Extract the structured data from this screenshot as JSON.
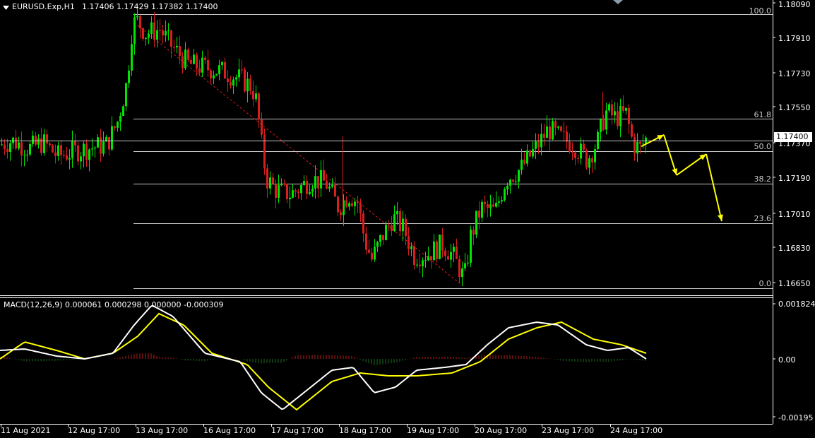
{
  "header": {
    "symbol": "EURUSD.Exp,H1",
    "ohlc": "1.17406 1.17429 1.17382 1.17400",
    "dropdown_icon": "triangle-down-icon"
  },
  "price_axis": {
    "labels": [
      "1.18090",
      "1.17910",
      "1.17730",
      "1.17550",
      "1.17370",
      "1.17190",
      "1.17010",
      "1.16830",
      "1.16650"
    ],
    "current_price": "1.17400"
  },
  "fibonacci": {
    "levels": [
      "100.0",
      "61.8",
      "50.0",
      "38.2",
      "23.6",
      "0.0"
    ]
  },
  "macd": {
    "title": "MACD(12,26,9) 0.000061 0.000298 0.000000 -0.000309",
    "axis_labels": [
      "0.001824",
      "0.00",
      "-0.00195"
    ]
  },
  "time_axis": {
    "labels": [
      "11 Aug 2021",
      "12 Aug 17:00",
      "13 Aug 17:00",
      "16 Aug 17:00",
      "17 Aug 17:00",
      "18 Aug 17:00",
      "19 Aug 17:00",
      "20 Aug 17:00",
      "23 Aug 17:00",
      "24 Aug 17:00"
    ]
  },
  "colors": {
    "bull": "#00e600",
    "bear": "#d81e1e",
    "macd_line": "#ffffff",
    "signal_line": "#ffff00",
    "projection": "#ffff00",
    "fib_line": "#c8c8c8"
  },
  "chart_data": {
    "type": "line",
    "title": "EURUSD.Exp,H1",
    "price_series": {
      "name": "EURUSD",
      "ylim": [
        1.166,
        1.181
      ],
      "x": [
        "11 Aug 2021",
        "12 Aug 17:00",
        "13 Aug 17:00",
        "16 Aug 17:00",
        "17 Aug 17:00",
        "18 Aug 17:00",
        "19 Aug 17:00",
        "20 Aug 17:00",
        "23 Aug 17:00",
        "24 Aug 17:00"
      ],
      "close": [
        1.1738,
        1.1738,
        1.1797,
        1.1775,
        1.1722,
        1.1701,
        1.1684,
        1.171,
        1.174,
        1.174
      ]
    },
    "fib_range": {
      "high": 1.1806,
      "low": 1.1663
    },
    "projection_points": [
      [
        1.1737,
        1.1743
      ],
      [
        1.1743,
        1.1722
      ],
      [
        1.1722,
        1.1733
      ],
      [
        1.1733,
        1.1698
      ]
    ],
    "macd_ylim": [
      -0.00205,
      0.00195
    ]
  }
}
